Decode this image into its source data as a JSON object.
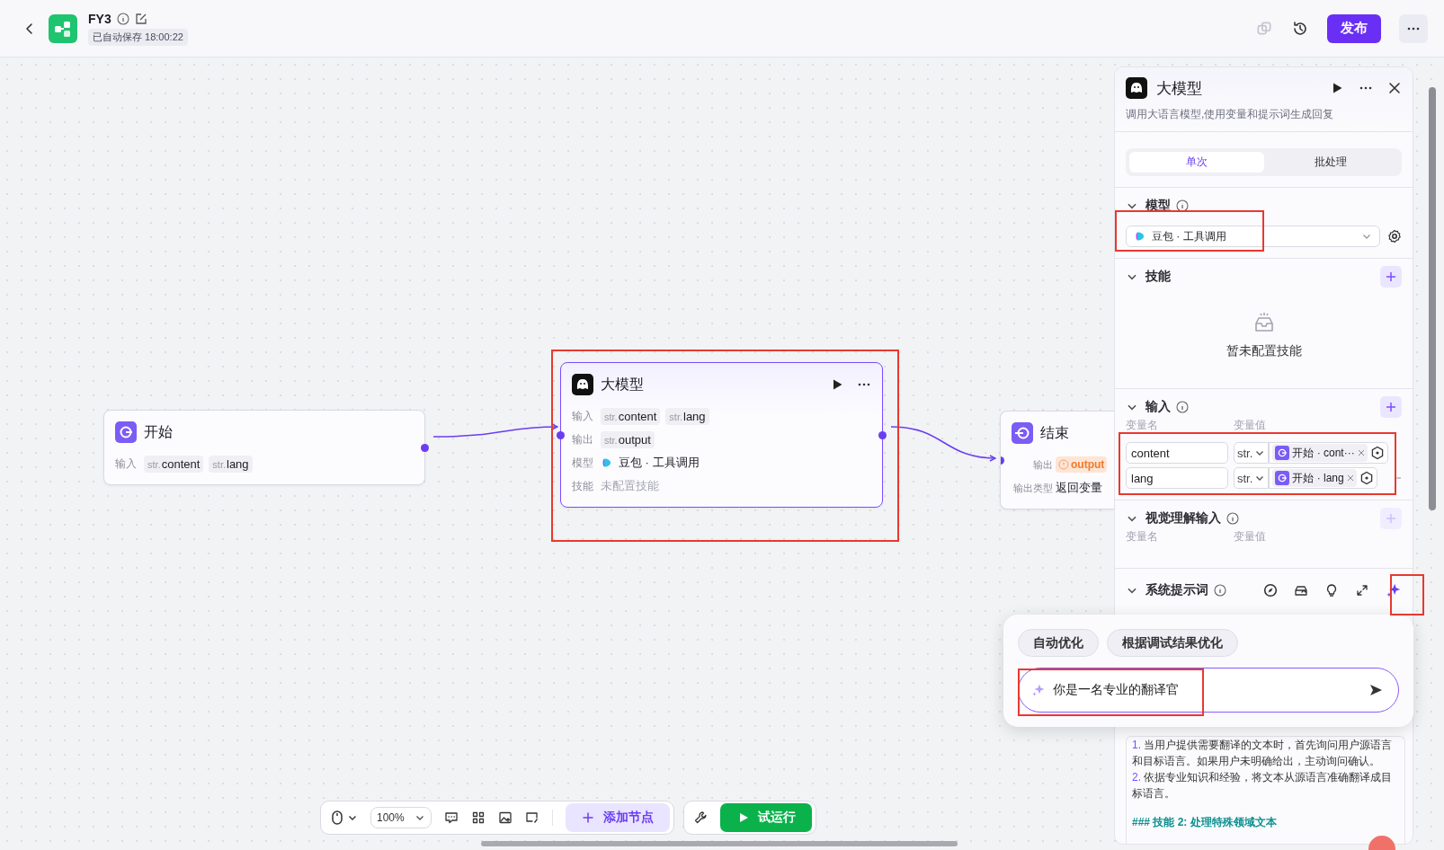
{
  "header": {
    "title": "FY3",
    "autosave": "已自动保存 18:00:22",
    "publish": "发布"
  },
  "nodes": [
    {
      "kind": "start",
      "title": "开始",
      "selected": false,
      "rows": [
        {
          "kind": "tags",
          "label": "输入",
          "tags": [
            {
              "type": "str.",
              "name": "content"
            },
            {
              "type": "str.",
              "name": "lang"
            }
          ]
        }
      ]
    },
    {
      "kind": "llm",
      "title": "大模型",
      "selected": true,
      "rows": [
        {
          "kind": "tags",
          "label": "输入",
          "tags": [
            {
              "type": "str.",
              "name": "content"
            },
            {
              "type": "str.",
              "name": "lang"
            }
          ]
        },
        {
          "kind": "tags",
          "label": "输出",
          "tags": [
            {
              "type": "str.",
              "name": "output"
            }
          ]
        },
        {
          "kind": "model",
          "label": "模型",
          "value": "豆包 · 工具调用"
        },
        {
          "kind": "text",
          "label": "技能",
          "value": "未配置技能",
          "muted": true
        }
      ]
    },
    {
      "kind": "end",
      "title": "结束",
      "selected": false,
      "rows": [
        {
          "kind": "warning",
          "label": "输出",
          "value": "output"
        },
        {
          "kind": "text",
          "label": "输出类型",
          "value": "返回变量",
          "muted": false
        }
      ]
    }
  ],
  "panel": {
    "title": "大模型",
    "description": "调用大语言模型,使用变量和提示词生成回复",
    "tabs": [
      {
        "label": "单次",
        "selected": true
      },
      {
        "label": "批处理",
        "selected": false
      }
    ],
    "sections": [
      {
        "kind": "model",
        "title": "模型",
        "expanded": true,
        "info": true,
        "value": "豆包 · 工具调用"
      },
      {
        "kind": "skills",
        "title": "技能",
        "expanded": true,
        "info": false,
        "add": {
          "disabled": false
        },
        "empty": "暂未配置技能"
      },
      {
        "kind": "inputs",
        "title": "输入",
        "expanded": true,
        "info": true,
        "add": {
          "disabled": false
        },
        "columns": [
          "变量名",
          "变量值"
        ],
        "rows": [
          {
            "name": "content",
            "type": "str.",
            "ref": "开始 · cont···"
          },
          {
            "name": "lang",
            "type": "str.",
            "ref": "开始 · lang"
          }
        ]
      },
      {
        "kind": "inputs",
        "title": "视觉理解输入",
        "expanded": true,
        "info": true,
        "add": {
          "disabled": true
        },
        "columns": [
          "变量名",
          "变量值"
        ]
      },
      {
        "kind": "prompt",
        "title": "系统提示词",
        "expanded": true,
        "info": true,
        "lines": [
          {
            "kind": "item",
            "number": "1.",
            "text": "当用户提供需要翻译的文本时，首先询问用户源语言和目标语言。如果用户未明确给出，主动询问确认。"
          },
          {
            "kind": "item",
            "number": "2.",
            "text": "依据专业知识和经验，将文本从源语言准确翻译成目标语言。"
          },
          {
            "kind": "heading",
            "text": "### 技能 2: 处理特殊领域文本"
          }
        ]
      }
    ]
  },
  "optimizer": {
    "chips": [
      "自动优化",
      "根据调试结果优化"
    ],
    "value": "你是一名专业的翻译官"
  },
  "toolbar": {
    "zoom": "100%",
    "add_node": "添加节点",
    "run": "试运行"
  }
}
